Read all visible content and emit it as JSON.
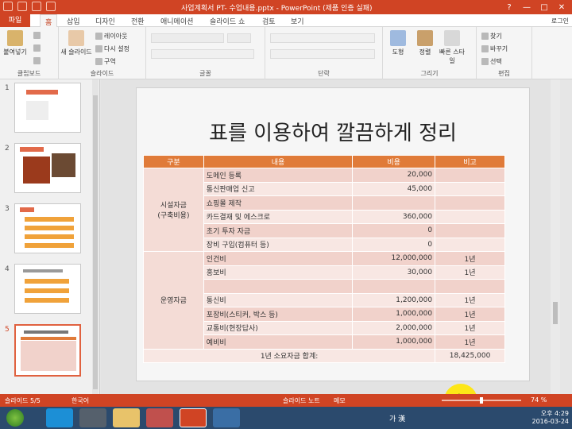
{
  "app": {
    "title": "사업계획서 PT- 수업내용.pptx - PowerPoint (제품 인증 실패)",
    "login": "로그인",
    "window_buttons": [
      "?",
      "—",
      "□",
      "✕"
    ]
  },
  "tabs": [
    {
      "label": "파일"
    },
    {
      "label": "홈"
    },
    {
      "label": "삽입"
    },
    {
      "label": "디자인"
    },
    {
      "label": "전환"
    },
    {
      "label": "애니메이션"
    },
    {
      "label": "슬라이드 쇼"
    },
    {
      "label": "검토"
    },
    {
      "label": "보기"
    }
  ],
  "ribbon": {
    "clipboard": {
      "paste": "붙여넣기",
      "label": "클립보드"
    },
    "slides": {
      "new_slide": "새 슬라이드",
      "layout": "레이아웃",
      "reset": "다시 설정",
      "section": "구역",
      "label": "슬라이드"
    },
    "font": {
      "label": "글꼴"
    },
    "paragraph": {
      "label": "단락"
    },
    "drawing": {
      "shape": "도형",
      "arrange": "정렬",
      "quick_styles": "빠른 스타일",
      "label": "그리기"
    },
    "editing": {
      "find": "찾기",
      "replace": "바꾸기",
      "select": "선택",
      "label": "편집"
    }
  },
  "thumbnails": [
    {
      "number": "1"
    },
    {
      "number": "2"
    },
    {
      "number": "3"
    },
    {
      "number": "4"
    },
    {
      "number": "5"
    }
  ],
  "slide": {
    "title": "표를 이용하여 깔끔하게 정리",
    "headers": [
      "구분",
      "내용",
      "비용",
      "비고"
    ],
    "group1": "시설자금\n(구축비용)",
    "group2": "운영자금",
    "rows": [
      {
        "item": "도메인 등록",
        "cost": "20,000",
        "note": ""
      },
      {
        "item": "통신판매업 신고",
        "cost": "45,000",
        "note": ""
      },
      {
        "item": "쇼핑몰 제작",
        "cost": "",
        "note": ""
      },
      {
        "item": "카드결재 및 에스크로",
        "cost": "360,000",
        "note": ""
      },
      {
        "item": "초기 투자 자금",
        "cost": "0",
        "note": ""
      },
      {
        "item": "장비 구입(컴퓨터 등)",
        "cost": "0",
        "note": ""
      },
      {
        "item": "인건비",
        "cost": "12,000,000",
        "note": "1년"
      },
      {
        "item": "홍보비",
        "cost": "30,000",
        "note": "1년"
      },
      {
        "item": "",
        "cost": "",
        "note": ""
      },
      {
        "item": "통신비",
        "cost": "1,200,000",
        "note": "1년"
      },
      {
        "item": "포장비(스티커, 박스 등)",
        "cost": "1,000,000",
        "note": "1년"
      },
      {
        "item": "교통비(현장답사)",
        "cost": "2,000,000",
        "note": "1년"
      },
      {
        "item": "예비비",
        "cost": "1,000,000",
        "note": "1년"
      }
    ],
    "total_label": "1년 소요자금 합계:",
    "total_value": "18,425,000"
  },
  "status": {
    "slide_info": "슬라이드 5/5",
    "language": "한국어",
    "notes": "슬라이드 노트",
    "comments": "메모",
    "zoom": "74 %",
    "zoom_level_fraction": 0.5
  },
  "taskbar": {
    "ime": "가 漢",
    "time": "오후 4:29",
    "date": "2016-03-24"
  },
  "colors": {
    "accent": "#d04424",
    "table_header": "#e07b39"
  }
}
